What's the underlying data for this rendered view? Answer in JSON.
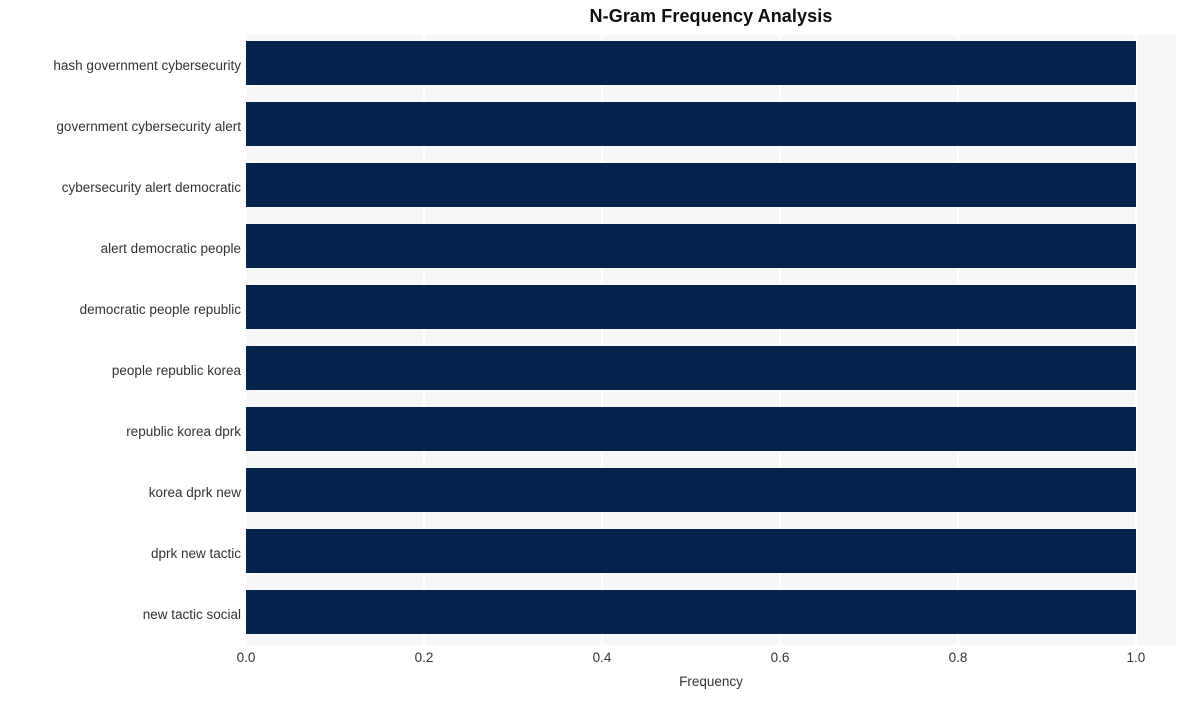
{
  "chart_data": {
    "type": "bar",
    "orientation": "horizontal",
    "title": "N-Gram Frequency Analysis",
    "xlabel": "Frequency",
    "ylabel": "",
    "categories": [
      "hash government cybersecurity",
      "government cybersecurity alert",
      "cybersecurity alert democratic",
      "alert democratic people",
      "democratic people republic",
      "people republic korea",
      "republic korea dprk",
      "korea dprk new",
      "dprk new tactic",
      "new tactic social"
    ],
    "values": [
      1.0,
      1.0,
      1.0,
      1.0,
      1.0,
      1.0,
      1.0,
      1.0,
      1.0,
      1.0
    ],
    "xlim": [
      0.0,
      1.045
    ],
    "xticks": [
      0.0,
      0.2,
      0.4,
      0.6,
      0.8,
      1.0
    ],
    "xtick_labels": [
      "0.0",
      "0.2",
      "0.4",
      "0.6",
      "0.8",
      "1.0"
    ],
    "grid": true,
    "grid_axis": "x",
    "grid_color": "#ffffff",
    "plot_background": "#f7f7f7",
    "figure_background": "#ffffff",
    "bar_color": "#04244C",
    "text_color": "#333333",
    "title_color": "#0d0d0d",
    "legend": null
  }
}
